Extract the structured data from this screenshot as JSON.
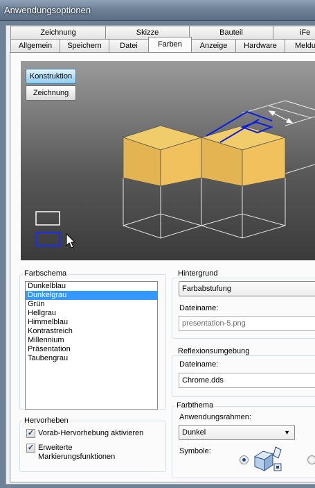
{
  "window": {
    "title": "Anwendungsoptionen"
  },
  "tabs": {
    "row_back": [
      "Zeichnung",
      "Skizze",
      "Bauteil",
      "iFe"
    ],
    "row_front": [
      "Allgemein",
      "Speichern",
      "Datei",
      "Farben",
      "Anzeige",
      "Hardware",
      "Meldu"
    ],
    "active": "Farben"
  },
  "preview": {
    "buttons": {
      "konstruktion": "Konstruktion",
      "zeichnung": "Zeichnung"
    },
    "active_button": "Konstruktion",
    "colors": {
      "cube_top": "#f1cc6a",
      "cube_left": "#e3b552",
      "cube_right": "#f0c15c",
      "highlight": "#0a1ee0"
    }
  },
  "farbschema": {
    "label": "Farbschema",
    "items": [
      "Dunkelblau",
      "Dunkelgrau",
      "Grün",
      "Hellgrau",
      "Himmelblau",
      "Kontrastreich",
      "Millennium",
      "Präsentation",
      "Taubengrau"
    ],
    "selected": "Dunkelgrau",
    "selected_color": "#3399ff"
  },
  "hintergrund": {
    "label": "Hintergrund",
    "value": "Farbabstufung",
    "dateiname_label": "Dateiname:",
    "dateiname_value": "presentation-5.png"
  },
  "reflexion": {
    "label": "Reflexionsumgebung",
    "dateiname_label": "Dateiname:",
    "dateiname_value": "Chrome.dds"
  },
  "hervorheben": {
    "label": "Hervorheben",
    "option1": "Vorab-Hervorhebung aktivieren",
    "option1_checked": true,
    "option2_line1": "Erweiterte",
    "option2_line2": "Markierungsfunktionen",
    "option2_checked": true
  },
  "farbthema": {
    "label": "Farbthema",
    "rahmen_label": "Anwendungsrahmen:",
    "rahmen_value": "Dunkel",
    "symbole_label": "Symbole:",
    "symbole_selected": 0
  }
}
